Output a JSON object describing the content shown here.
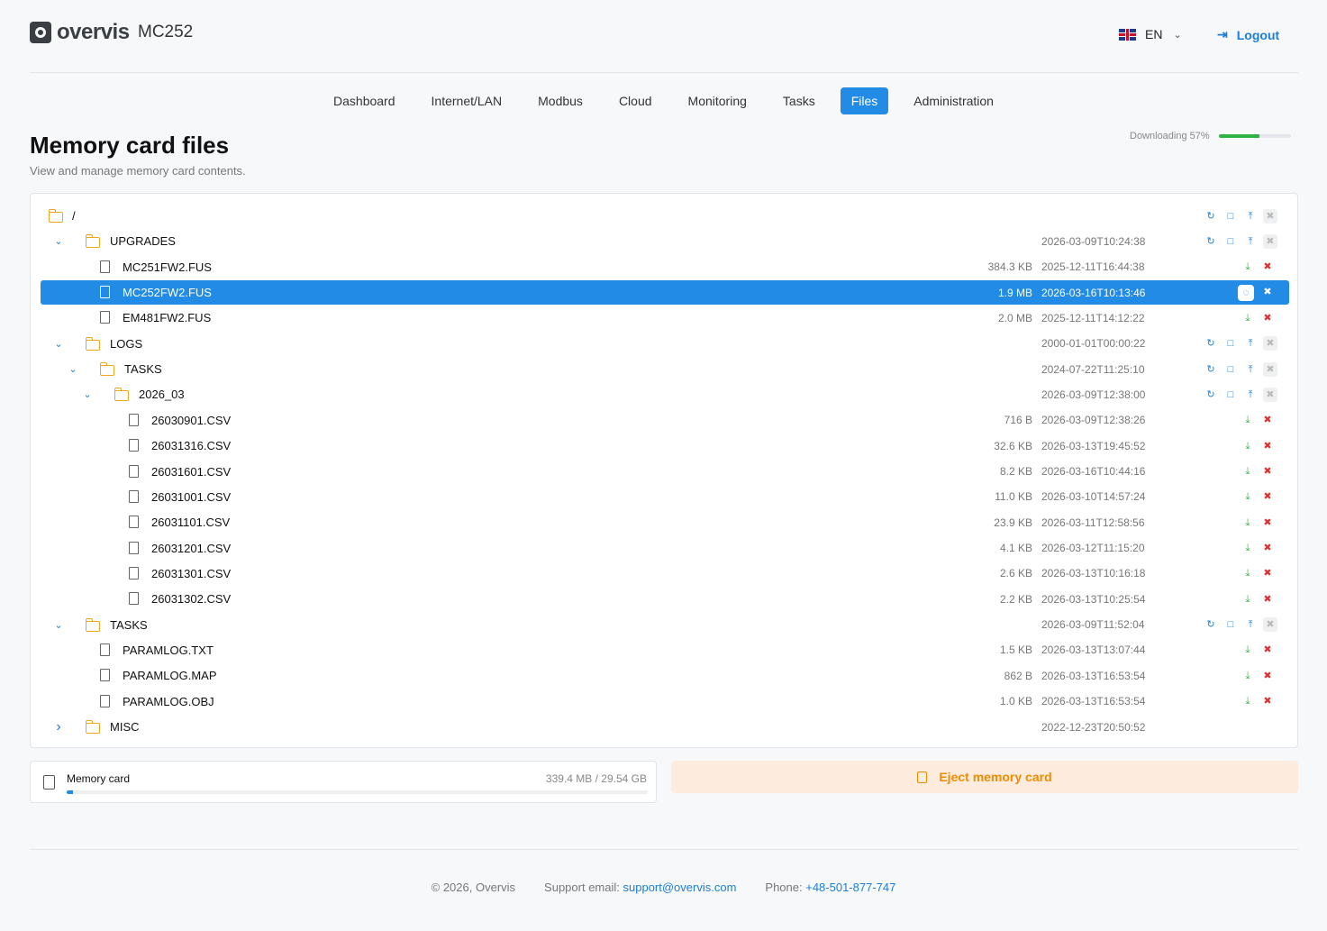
{
  "header": {
    "logo_text": "overvis",
    "device": "MC252",
    "language": "EN",
    "logout_label": "Logout"
  },
  "nav": {
    "items": [
      "Dashboard",
      "Internet/LAN",
      "Modbus",
      "Cloud",
      "Monitoring",
      "Tasks",
      "Files",
      "Administration"
    ],
    "active": "Files"
  },
  "page": {
    "title": "Memory card files",
    "subtitle": "View and manage memory card contents.",
    "download_status": "Downloading 57%",
    "download_progress": 0.57
  },
  "tree": [
    {
      "type": "folder",
      "depth": 0,
      "name": "/",
      "date": "",
      "expanded": null,
      "root": true
    },
    {
      "type": "folder",
      "depth": 1,
      "name": "UPGRADES",
      "date": "2026-03-09T10:24:38",
      "expanded": true
    },
    {
      "type": "file",
      "depth": 2,
      "name": "MC251FW2.FUS",
      "size": "384.3 KB",
      "date": "2025-12-11T16:44:38"
    },
    {
      "type": "file",
      "depth": 2,
      "name": "MC252FW2.FUS",
      "size": "1.9 MB",
      "date": "2026-03-16T10:13:46",
      "selected": true
    },
    {
      "type": "file",
      "depth": 2,
      "name": "EM481FW2.FUS",
      "size": "2.0 MB",
      "date": "2025-12-11T14:12:22"
    },
    {
      "type": "folder",
      "depth": 1,
      "name": "LOGS",
      "date": "2000-01-01T00:00:22",
      "expanded": true
    },
    {
      "type": "folder",
      "depth": 2,
      "name": "TASKS",
      "date": "2024-07-22T11:25:10",
      "expanded": true
    },
    {
      "type": "folder",
      "depth": 3,
      "name": "2026_03",
      "date": "2026-03-09T12:38:00",
      "expanded": true
    },
    {
      "type": "file",
      "depth": 4,
      "name": "26030901.CSV",
      "size": "716 B",
      "date": "2026-03-09T12:38:26"
    },
    {
      "type": "file",
      "depth": 4,
      "name": "26031316.CSV",
      "size": "32.6 KB",
      "date": "2026-03-13T19:45:52"
    },
    {
      "type": "file",
      "depth": 4,
      "name": "26031601.CSV",
      "size": "8.2 KB",
      "date": "2026-03-16T10:44:16"
    },
    {
      "type": "file",
      "depth": 4,
      "name": "26031001.CSV",
      "size": "11.0 KB",
      "date": "2026-03-10T14:57:24"
    },
    {
      "type": "file",
      "depth": 4,
      "name": "26031101.CSV",
      "size": "23.9 KB",
      "date": "2026-03-11T12:58:56"
    },
    {
      "type": "file",
      "depth": 4,
      "name": "26031201.CSV",
      "size": "4.1 KB",
      "date": "2026-03-12T11:15:20"
    },
    {
      "type": "file",
      "depth": 4,
      "name": "26031301.CSV",
      "size": "2.6 KB",
      "date": "2026-03-13T10:16:18"
    },
    {
      "type": "file",
      "depth": 4,
      "name": "26031302.CSV",
      "size": "2.2 KB",
      "date": "2026-03-13T10:25:54"
    },
    {
      "type": "folder",
      "depth": 1,
      "name": "TASKS",
      "date": "2026-03-09T11:52:04",
      "expanded": true
    },
    {
      "type": "file",
      "depth": 2,
      "name": "PARAMLOG.TXT",
      "size": "1.5 KB",
      "date": "2026-03-13T13:07:44"
    },
    {
      "type": "file",
      "depth": 2,
      "name": "PARAMLOG.MAP",
      "size": "862 B",
      "date": "2026-03-13T16:53:54"
    },
    {
      "type": "file",
      "depth": 2,
      "name": "PARAMLOG.OBJ",
      "size": "1.0 KB",
      "date": "2026-03-13T16:53:54"
    },
    {
      "type": "folder",
      "depth": 1,
      "name": "MISC",
      "date": "2022-12-23T20:50:52",
      "expanded": false,
      "no_actions": true
    }
  ],
  "memory": {
    "label": "Memory card",
    "usage": "339.4 MB / 29.54 GB",
    "used_fraction": 0.011
  },
  "eject_label": "Eject memory card",
  "footer": {
    "copyright": "© 2026, Overvis",
    "support_label": "Support email:",
    "support_email": "support@overvis.com",
    "phone_label": "Phone:",
    "phone": "+48-501-877-747"
  },
  "colors": {
    "accent": "#228be6",
    "folder": "#f0a51c",
    "progress": "#2fb344",
    "eject_bg": "#fdebde",
    "eject_text": "#f08c00"
  }
}
